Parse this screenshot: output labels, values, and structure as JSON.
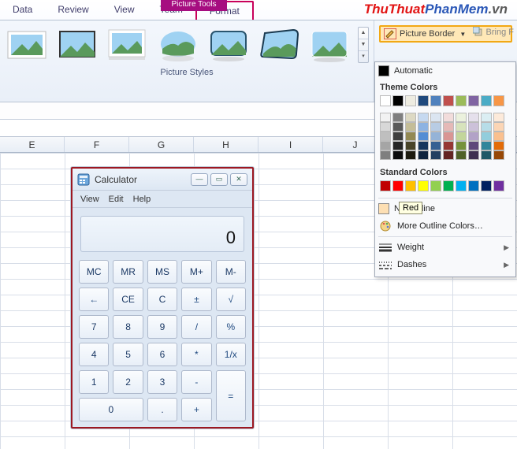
{
  "tabs": {
    "data": "Data",
    "review": "Review",
    "view": "View",
    "team": "Team",
    "format": "Format",
    "context": "Picture Tools"
  },
  "watermark": {
    "p1": "ThuThuat",
    "p2": "PhanMem",
    "p3": ".vn"
  },
  "ribbon": {
    "group_label": "Picture Styles",
    "picture_border": "Picture Border",
    "bring_forward": "Bring F"
  },
  "cols": [
    "E",
    "F",
    "G",
    "H",
    "I",
    "J"
  ],
  "calc": {
    "title": "Calculator",
    "menu": {
      "view": "View",
      "edit": "Edit",
      "help": "Help"
    },
    "display": "0",
    "keys": {
      "mc": "MC",
      "mr": "MR",
      "ms": "MS",
      "mp": "M+",
      "mm": "M-",
      "bk": "←",
      "ce": "CE",
      "c": "C",
      "pm": "±",
      "sq": "√",
      "k7": "7",
      "k8": "8",
      "k9": "9",
      "div": "/",
      "pc": "%",
      "k4": "4",
      "k5": "5",
      "k6": "6",
      "mul": "*",
      "inv": "1/x",
      "k1": "1",
      "k2": "2",
      "k3": "3",
      "min": "-",
      "eq": "=",
      "k0": "0",
      "dot": ".",
      "plus": "+"
    }
  },
  "dd": {
    "automatic": "Automatic",
    "theme": "Theme Colors",
    "theme_row": [
      "#ffffff",
      "#000000",
      "#eeece1",
      "#1f497d",
      "#4f81bd",
      "#c0504d",
      "#9bbb59",
      "#8064a2",
      "#4bacc6",
      "#f79646"
    ],
    "theme_tints": [
      [
        "#f2f2f2",
        "#7f7f7f",
        "#ddd9c3",
        "#c6d9f0",
        "#dbe5f1",
        "#f2dcdb",
        "#ebf1dd",
        "#e5e0ec",
        "#dbeef3",
        "#fdeada"
      ],
      [
        "#d8d8d8",
        "#595959",
        "#c4bd97",
        "#8db3e2",
        "#b8cce4",
        "#e5b9b7",
        "#d7e3bc",
        "#ccc1d9",
        "#b7dde8",
        "#fbd5b5"
      ],
      [
        "#bfbfbf",
        "#3f3f3f",
        "#938953",
        "#548dd4",
        "#95b3d7",
        "#d99694",
        "#c3d69b",
        "#b2a2c7",
        "#92cddc",
        "#fac08f"
      ],
      [
        "#a5a5a5",
        "#262626",
        "#494429",
        "#17365d",
        "#366092",
        "#953734",
        "#76923c",
        "#5f497a",
        "#31859b",
        "#e36c09"
      ],
      [
        "#7f7f7f",
        "#0c0c0c",
        "#1d1b10",
        "#0f243e",
        "#244061",
        "#632423",
        "#4f6128",
        "#3f3151",
        "#205867",
        "#974806"
      ]
    ],
    "standard_hdr": "Standard Colors",
    "standard": [
      "#c00000",
      "#ff0000",
      "#ffc000",
      "#ffff00",
      "#92d050",
      "#00b050",
      "#00b0f0",
      "#0070c0",
      "#002060",
      "#7030a0"
    ],
    "no_outline": "No Outline",
    "more": "More Outline Colors…",
    "weight": "Weight",
    "dashes": "Dashes",
    "tooltip": "Red",
    "hover_sw": "#fddfb3"
  }
}
